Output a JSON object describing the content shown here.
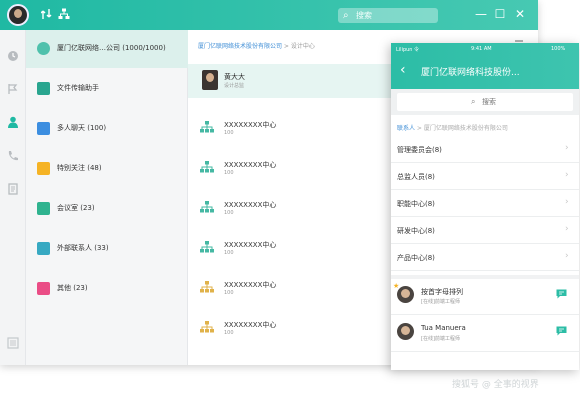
{
  "titlebar": {
    "search_placeholder": "搜索",
    "search_icon": "search-icon",
    "win_min": "—",
    "win_max": "☐",
    "win_close": "✕",
    "accent": "#1fb9a3"
  },
  "left_nav": [
    "clock-icon",
    "flag-icon",
    "person-icon",
    "phone-icon",
    "doc-icon",
    "more-icon"
  ],
  "contacts": [
    {
      "label": "厦门亿联网络…公司 (1000/1000)",
      "icon_color": "#4fc1ac",
      "selected": true
    },
    {
      "label": "文件传输助手",
      "icon_color": "#29a58f"
    },
    {
      "label": "多人聊天 (100)",
      "icon_color": "#3c8ee0"
    },
    {
      "label": "特别关注 (48)",
      "icon_color": "#f5b325"
    },
    {
      "label": "会议室 (23)",
      "icon_color": "#2fb38f"
    },
    {
      "label": "外部联系人 (33)",
      "icon_color": "#37a9c2"
    },
    {
      "label": "其他 (23)",
      "icon_color": "#ea4d86"
    }
  ],
  "main": {
    "breadcrumb_link": "厦门亿联网络技术股份有限公司",
    "breadcrumb_sep": " > ",
    "breadcrumb_current": "设计中心",
    "highlight": {
      "name": "黄大大",
      "sub": "设计总监"
    },
    "departments": [
      {
        "name": "XXXXXXXX中心",
        "count": "100",
        "color": "#45b8a3"
      },
      {
        "name": "XXXXXXXX中心",
        "count": "100",
        "color": "#45b8a3"
      },
      {
        "name": "XXXXXXXX中心",
        "count": "100",
        "color": "#45b8a3"
      },
      {
        "name": "XXXXXXXX中心",
        "count": "100",
        "color": "#45b8a3"
      },
      {
        "name": "XXXXXXXX中心",
        "count": "100",
        "color": "#e0b24a"
      },
      {
        "name": "XXXXXXXX中心",
        "count": "100",
        "color": "#e0b24a"
      }
    ]
  },
  "phone": {
    "status_left": "Lilipun 令",
    "status_time": "9:41 AM",
    "status_right": "100%",
    "back": "‹",
    "title": "厦门亿联网络科技股份...",
    "search_placeholder": "搜索",
    "breadcrumb_link": "联系人",
    "breadcrumb_rest": " > 厦门亿联网络技术股份有限公司",
    "list": [
      "管理委员会(8)",
      "总监人员(8)",
      "职能中心(8)",
      "研发中心(8)",
      "产品中心(8)"
    ],
    "people": [
      {
        "name": "按首字母排列",
        "sub": "[在线]前端工程师",
        "starred": true
      },
      {
        "name": "Tua Manuera",
        "sub": "[在线]前端工程师",
        "starred": false
      }
    ]
  },
  "watermark": "搜狐号 @ 全事的视界"
}
